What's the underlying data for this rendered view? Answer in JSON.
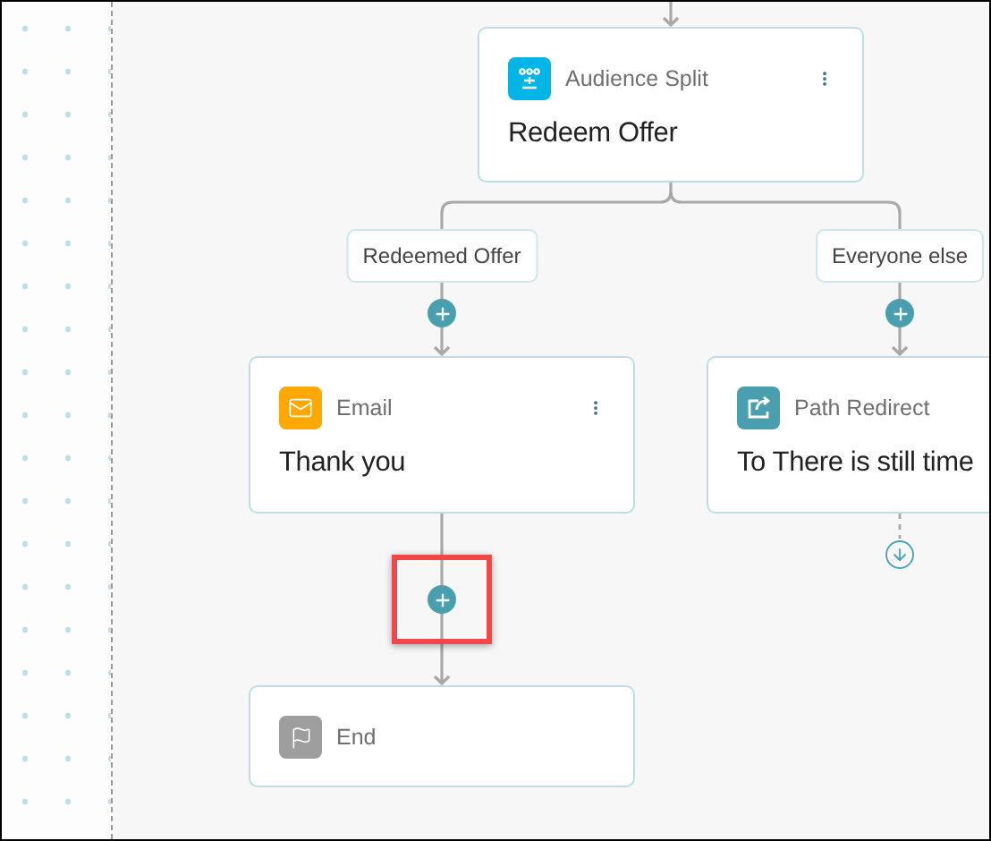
{
  "split": {
    "kind": "split",
    "type": "Audience Split",
    "title": "Redeem Offer",
    "menu": true
  },
  "branches": [
    {
      "label": "Redeemed Offer",
      "steps": [
        {
          "kind": "email",
          "type": "Email",
          "title": "Thank you",
          "menu": true
        },
        {
          "kind": "add",
          "highlighted": true
        },
        {
          "kind": "end",
          "type": "End"
        }
      ]
    },
    {
      "label": "Everyone else",
      "steps": [
        {
          "kind": "redirect",
          "type": "Path Redirect",
          "title": "To There is still time",
          "menu": false
        }
      ]
    }
  ]
}
